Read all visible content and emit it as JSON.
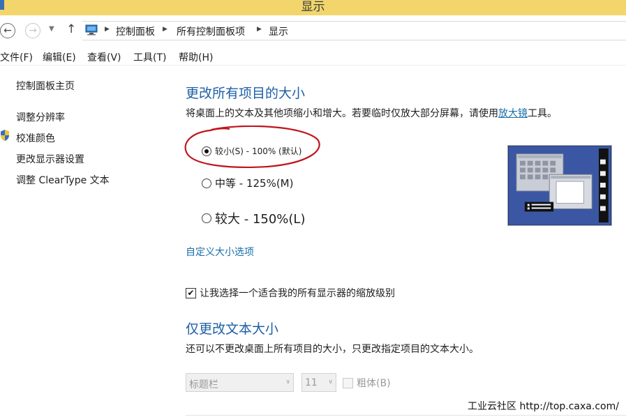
{
  "window": {
    "title": "显示"
  },
  "address_bar": {
    "crumbs": [
      "控制面板",
      "所有控制面板项",
      "显示"
    ]
  },
  "menu": {
    "items": [
      "文件(F)",
      "编辑(E)",
      "查看(V)",
      "工具(T)",
      "帮助(H)"
    ]
  },
  "sidebar": {
    "home": "控制面板主页",
    "items": [
      "调整分辨率",
      "校准颜色",
      "更改显示器设置",
      "调整 ClearType 文本"
    ]
  },
  "main": {
    "heading1": "更改所有项目的大小",
    "description_before": "将桌面上的文本及其他项缩小和增大。若要临时仅放大部分屏幕，请使用",
    "magnifier_link": "放大镜",
    "description_after": "工具。",
    "size_options": [
      {
        "label": "较小(S) - 100% (默认)",
        "checked": true
      },
      {
        "label": "中等 - 125%(M)",
        "checked": false
      },
      {
        "label": "较大 - 150%(L)",
        "checked": false
      }
    ],
    "custom_size_link": "自定义大小选项",
    "scale_checkbox_label": "让我选择一个适合我的所有显示器的缩放级别",
    "scale_checkbox_checked": true,
    "heading2": "仅更改文本大小",
    "text_description": "还可以不更改桌面上所有项目的大小，只更改指定项目的文本大小。",
    "item_select_value": "标题栏",
    "font_size_value": "11",
    "bold_label": "粗体(B)",
    "bold_checked": false
  },
  "watermark": "工业云社区 http://top.caxa.com/",
  "colors": {
    "titlebar": "#f2d66b",
    "heading": "#1d5fa6",
    "link": "#1a6ea8",
    "annotation": "#c0141c",
    "preview_bg": "#3b57a3"
  },
  "icons": [
    "back-arrow-icon",
    "forward-arrow-icon",
    "dropdown-icon",
    "up-arrow-icon",
    "computer-icon",
    "shield-icon",
    "display-preview-icon"
  ]
}
